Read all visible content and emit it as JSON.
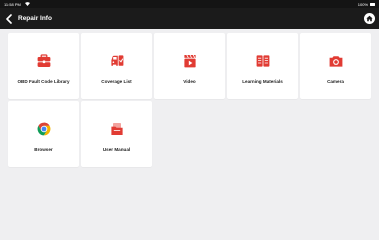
{
  "status_bar": {
    "time": "11:58 PM",
    "battery": "100%"
  },
  "header": {
    "title": "Repair Info"
  },
  "accent_color": "#e13b33",
  "tiles": [
    {
      "label": "OBD Fault Code Library",
      "icon": "toolbox-icon"
    },
    {
      "label": "Coverage List",
      "icon": "car-coverage-icon"
    },
    {
      "label": "Video",
      "icon": "video-clapper-icon"
    },
    {
      "label": "Learning Materials",
      "icon": "open-book-icon"
    },
    {
      "label": "Camera",
      "icon": "camera-icon"
    },
    {
      "label": "Browser",
      "icon": "chrome-icon"
    },
    {
      "label": "User Manual",
      "icon": "manual-folder-icon"
    }
  ]
}
